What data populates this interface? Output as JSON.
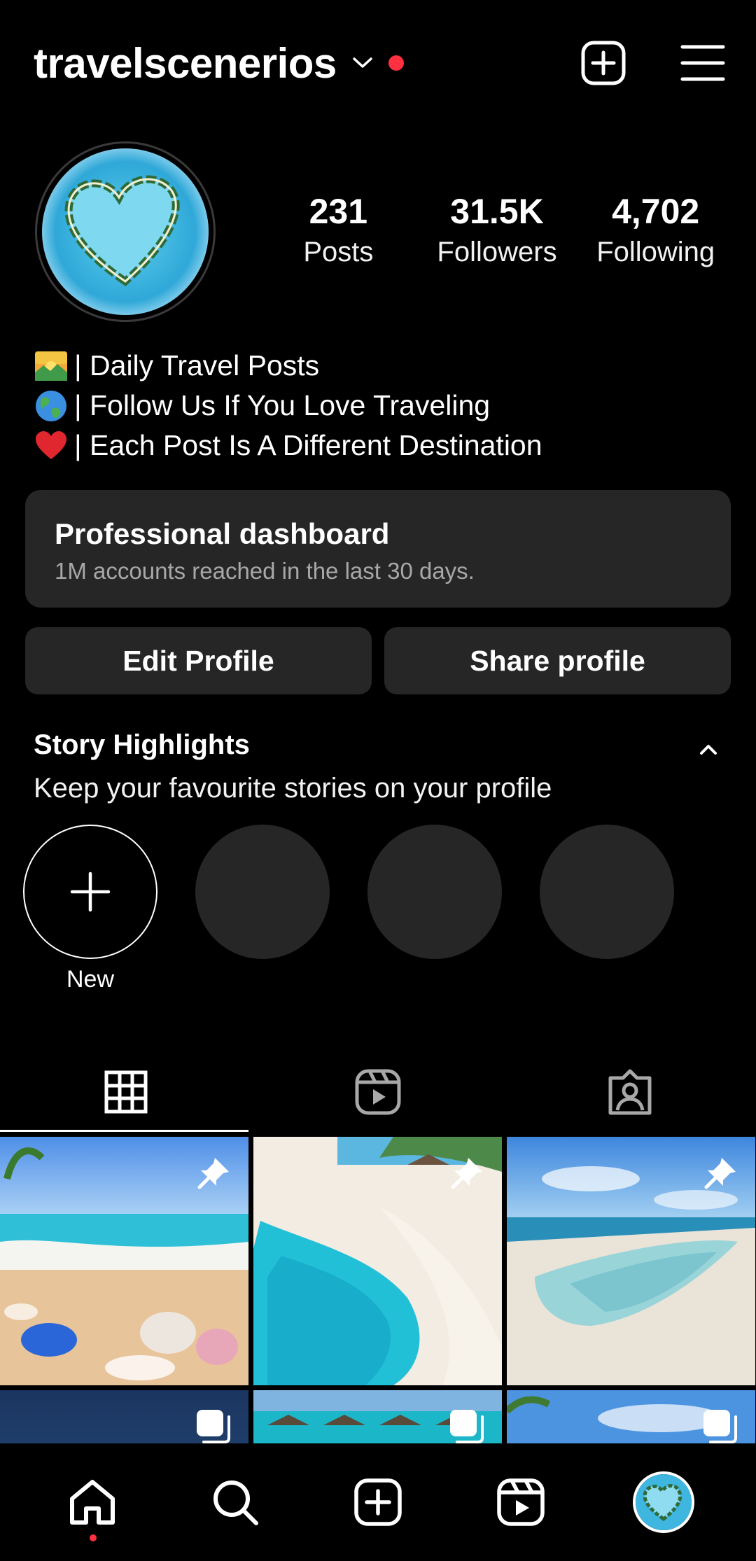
{
  "header": {
    "username": "travelscenerios",
    "notification_color": "#ff3040",
    "create_icon": "plus-square-icon",
    "menu_icon": "hamburger-menu-icon"
  },
  "profile": {
    "avatar": "heart-island-avatar",
    "stats": [
      {
        "value": "231",
        "label": "Posts"
      },
      {
        "value": "31.5K",
        "label": "Followers"
      },
      {
        "value": "4,702",
        "label": "Following"
      }
    ],
    "bio": [
      {
        "emoji": "sunrise-emoji",
        "text": "| Daily Travel Posts"
      },
      {
        "emoji": "globe-emoji",
        "text": "| Follow Us If You Love Traveling"
      },
      {
        "emoji": "red-heart-emoji",
        "text": "| Each Post Is A Different Destination"
      }
    ]
  },
  "dashboard": {
    "title": "Professional dashboard",
    "subtitle": "1M accounts reached in the last 30 days."
  },
  "buttons": {
    "edit": "Edit Profile",
    "share": "Share profile"
  },
  "highlights": {
    "title": "Story Highlights",
    "subtitle": "Keep your favourite stories on your profile",
    "new_label": "New"
  },
  "tabs": [
    "grid-icon",
    "reels-icon",
    "tagged-icon"
  ],
  "grid": [
    {
      "name": "beach-shells",
      "badge": "pin-icon"
    },
    {
      "name": "sandbar-lagoon",
      "badge": "pin-icon"
    },
    {
      "name": "tidal-beach",
      "badge": "pin-icon"
    },
    {
      "name": "ocean-dusk",
      "badge": "carousel-icon"
    },
    {
      "name": "overwater-villas",
      "badge": "carousel-icon"
    },
    {
      "name": "palm-sky",
      "badge": "carousel-icon"
    }
  ],
  "bottom_nav": [
    "home-icon",
    "search-icon",
    "create-icon",
    "reels-icon",
    "profile-avatar"
  ]
}
